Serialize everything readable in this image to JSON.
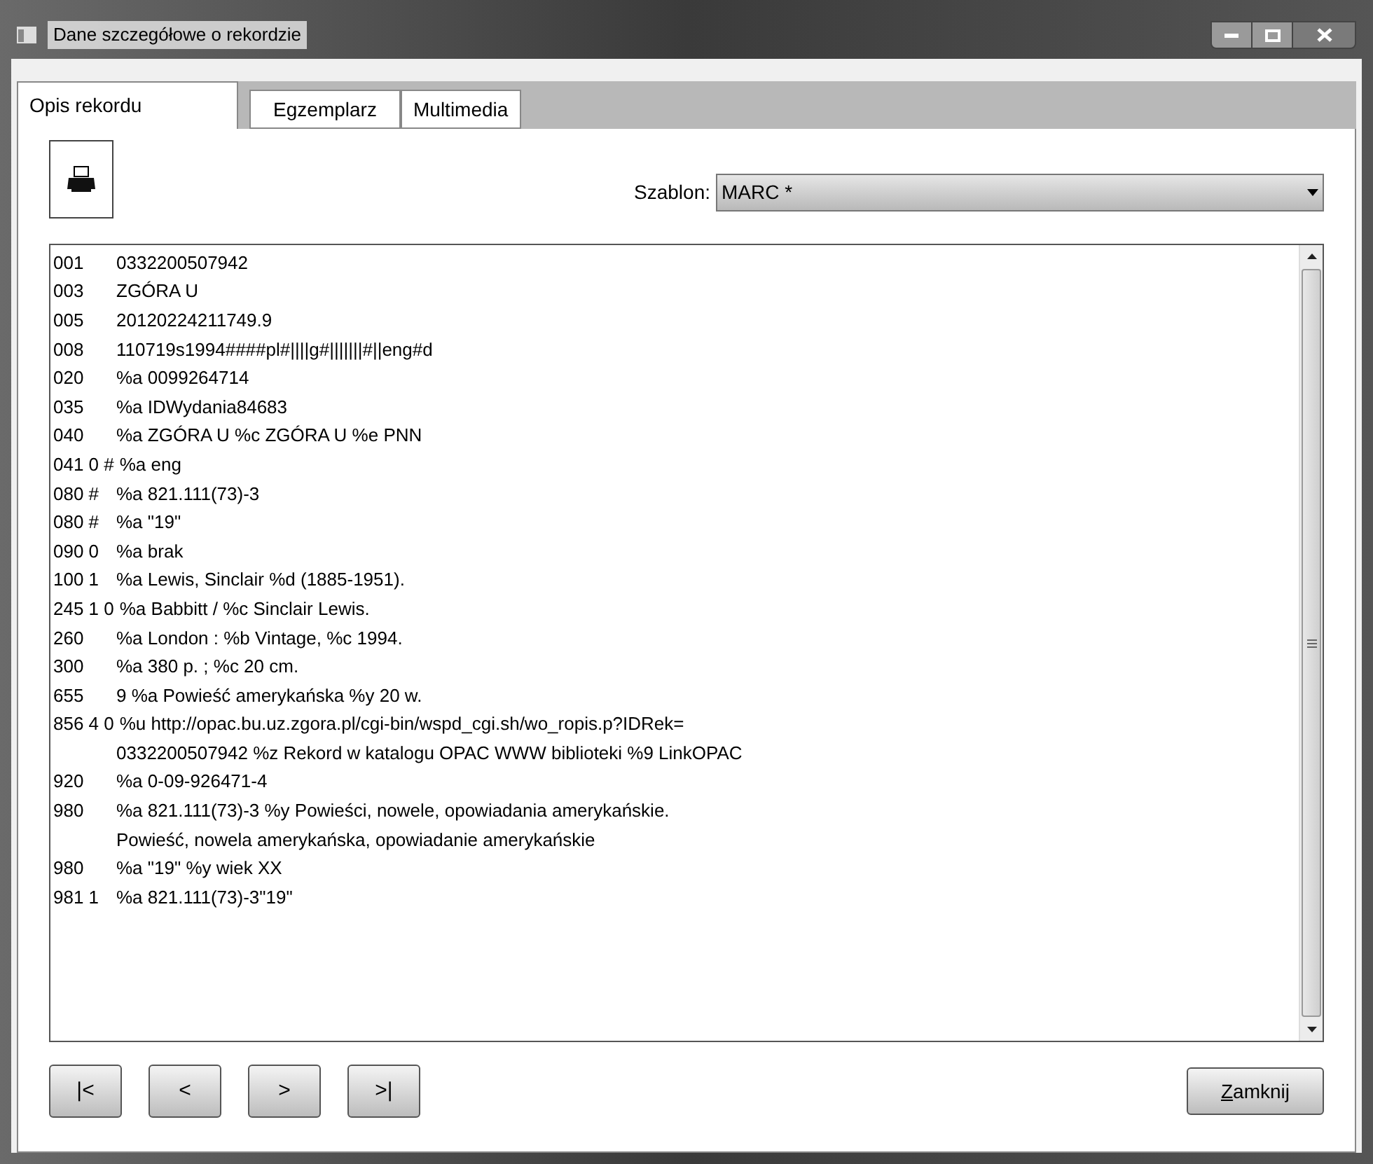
{
  "window": {
    "title": "Dane szczegółowe o rekordzie"
  },
  "tabs": [
    {
      "label": "Opis rekordu",
      "selected": true
    },
    {
      "label": "Egzemplarz",
      "selected": false
    },
    {
      "label": "Multimedia",
      "selected": false
    }
  ],
  "template": {
    "label": "Szablon:",
    "value": "MARC *"
  },
  "record_lines": [
    {
      "tag": "001",
      "text": "0332200507942"
    },
    {
      "tag": "003",
      "text": "ZGÓRA U"
    },
    {
      "tag": "005",
      "text": "20120224211749.9"
    },
    {
      "tag": "008",
      "text": "110719s1994####pl#||||g#|||||||#||eng#d"
    },
    {
      "tag": "020",
      "text": "%a 0099264714"
    },
    {
      "tag": "035",
      "text": "%a IDWydania84683"
    },
    {
      "tag": "040",
      "text": "%a ZGÓRA U %c ZGÓRA U %e PNN"
    },
    {
      "tag": "041 0 #",
      "text": "%a eng"
    },
    {
      "tag": "080 #",
      "text": "%a 821.111(73)-3"
    },
    {
      "tag": "080 #",
      "text": "%a \"19\""
    },
    {
      "tag": "090 0",
      "text": "%a brak"
    },
    {
      "tag": "100 1",
      "text": "%a Lewis, Sinclair %d (1885-1951)."
    },
    {
      "tag": "245 1 0",
      "text": "%a Babbitt / %c Sinclair Lewis."
    },
    {
      "tag": "260",
      "text": "%a London : %b Vintage, %c 1994."
    },
    {
      "tag": "300",
      "text": "%a 380 p. ; %c 20 cm."
    },
    {
      "tag": "655",
      "text": "9 %a Powieść amerykańska %y 20 w."
    },
    {
      "tag": "856 4 0",
      "text": "%u http://opac.bu.uz.zgora.pl/cgi-bin/wspd_cgi.sh/wo_ropis.p?IDRek="
    },
    {
      "text": "0332200507942 %z Rekord w katalogu OPAC WWW biblioteki %9 LinkOPAC"
    },
    {
      "tag": "920",
      "text": "%a 0-09-926471-4"
    },
    {
      "tag": "980",
      "text": "%a 821.111(73)-3 %y Powieści, nowele, opowiadania amerykańskie."
    },
    {
      "text": "Powieść, nowela amerykańska, opowiadanie amerykańskie"
    },
    {
      "tag": "980",
      "text": "%a \"19\" %y wiek XX"
    },
    {
      "tag": "981 1",
      "text": "%a 821.111(73)-3\"19\""
    }
  ],
  "nav_buttons": [
    "|<",
    "<",
    ">",
    ">|"
  ],
  "close_button": "Zamknij"
}
